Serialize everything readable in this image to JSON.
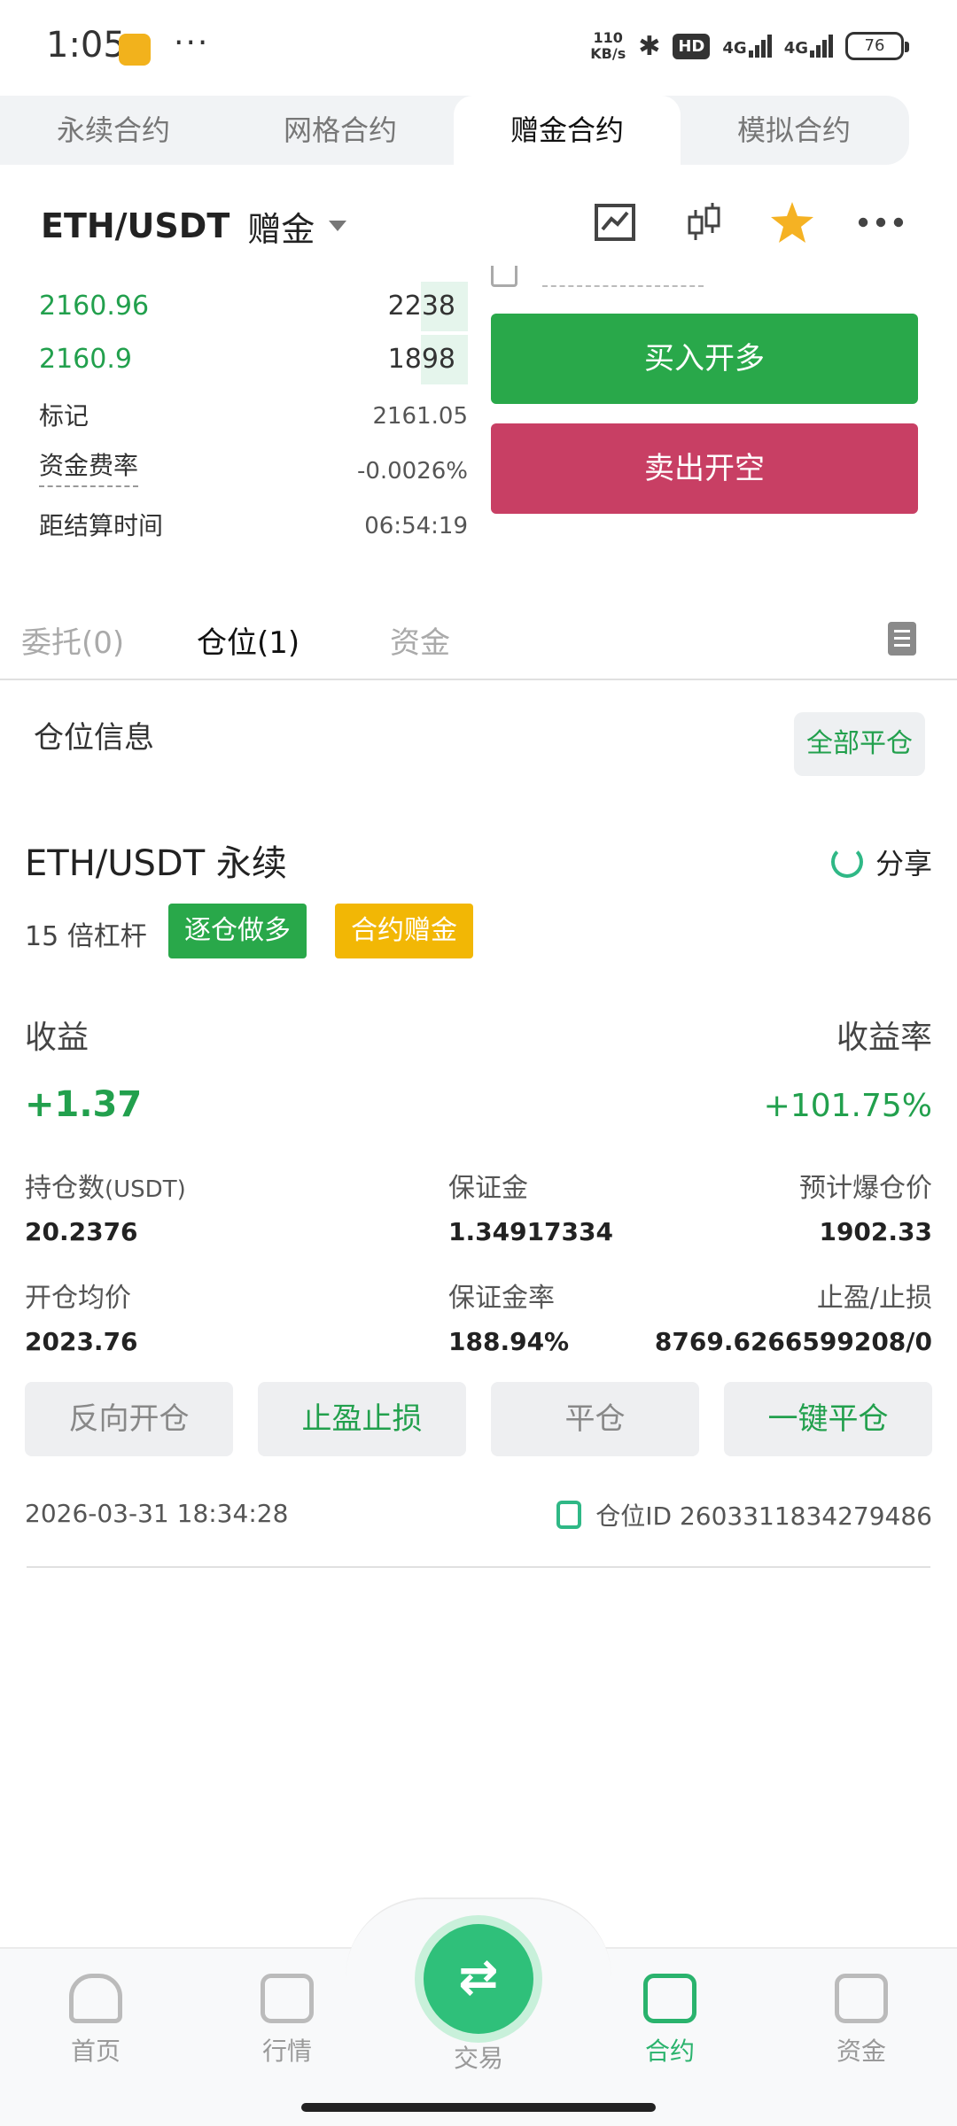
{
  "status_bar": {
    "time": "1:05",
    "more": "···",
    "speed_value": "110",
    "speed_unit": "KB/s",
    "hd": "HD",
    "net1": "4G",
    "net2": "4G",
    "battery": "76"
  },
  "contract_tabs": [
    {
      "label": "永续合约",
      "active": false
    },
    {
      "label": "网格合约",
      "active": false
    },
    {
      "label": "赠金合约",
      "active": true
    },
    {
      "label": "模拟合约",
      "active": false
    }
  ],
  "header": {
    "symbol": "ETH/USDT",
    "tag": "赠金",
    "icons": [
      "line-chart-icon",
      "candlestick-icon",
      "star-icon",
      "more-icon"
    ],
    "star_color": "#f5b223"
  },
  "order_book": {
    "bids": [
      {
        "price": "2160.96",
        "qty": "2238",
        "depth": 0.11
      },
      {
        "price": "2160.9",
        "qty": "1898",
        "depth": 0.11
      }
    ],
    "mark_label": "标记",
    "mark_value": "2161.05",
    "funding_label": "资金费率",
    "funding_value": "-0.0026%",
    "settle_label": "距结算时间",
    "settle_value": "06:54:19"
  },
  "trade_buttons": {
    "buy": "买入开多",
    "sell": "卖出开空",
    "buy_color": "#29a84a",
    "sell_color": "#c83f64"
  },
  "lower_tabs": [
    {
      "label": "委托(0)",
      "active": false
    },
    {
      "label": "仓位(1)",
      "active": true
    },
    {
      "label": "资金",
      "active": false
    }
  ],
  "position": {
    "section_title": "仓位信息",
    "close_all": "全部平仓",
    "pair": "ETH/USDT 永续",
    "share": "分享",
    "leverage": "15 倍杠杆",
    "badge_mode": "逐仓做多",
    "badge_bonus": "合约赠金",
    "pnl_label": "收益",
    "pnl_value": "+1.37",
    "pnl_rate_label": "收益率",
    "pnl_rate_value": "+101.75%",
    "size_label": "持仓数",
    "size_unit": "(USDT)",
    "size_value": "20.2376",
    "margin_label": "保证金",
    "margin_value": "1.34917334",
    "liq_label": "预计爆仓价",
    "liq_value": "1902.33",
    "entry_label": "开仓均价",
    "entry_value": "2023.76",
    "margin_rate_label": "保证金率",
    "margin_rate_value": "188.94%",
    "tpsl_label": "止盈/止损",
    "tpsl_value": "8769.6266599208/0",
    "actions": [
      "反向开仓",
      "止盈止损",
      "平仓",
      "一键平仓"
    ],
    "opened_at": "2026-03-31 18:34:28",
    "position_id": "仓位ID 2603311834279486"
  },
  "bottom_nav": [
    {
      "label": "首页",
      "icon": "home-icon",
      "active": false
    },
    {
      "label": "行情",
      "icon": "market-icon",
      "active": false
    },
    {
      "label": "交易",
      "icon": "swap-icon",
      "active": false
    },
    {
      "label": "合约",
      "icon": "contract-icon",
      "active": true
    },
    {
      "label": "资金",
      "icon": "wallet-icon",
      "active": false
    }
  ],
  "accent_color": "#2ab36d"
}
